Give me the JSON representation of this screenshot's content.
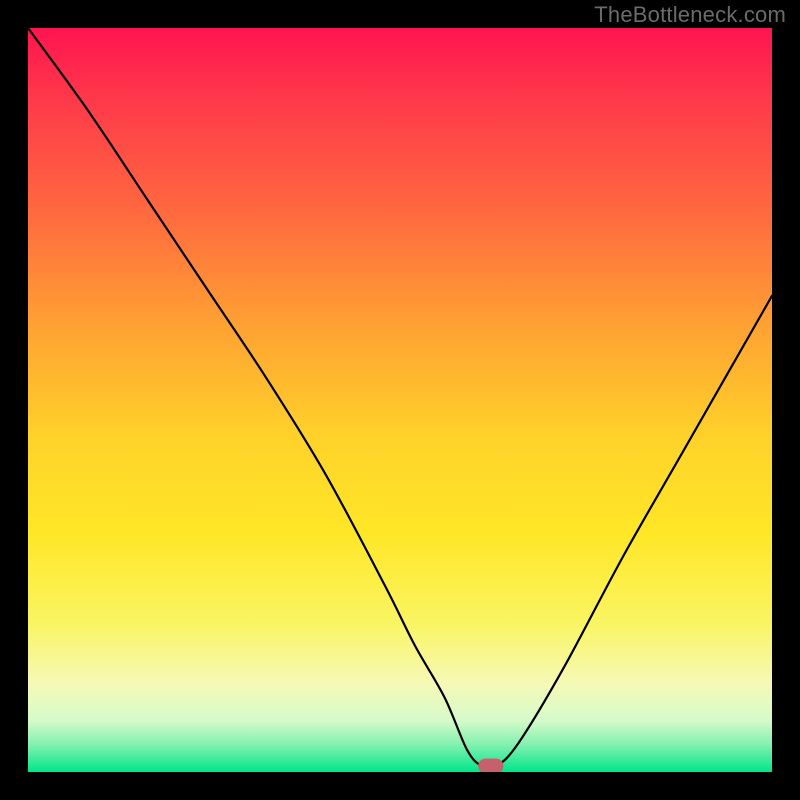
{
  "watermark": "TheBottleneck.com",
  "chart_data": {
    "type": "line",
    "title": "",
    "xlabel": "",
    "ylabel": "",
    "xlim": [
      0,
      100
    ],
    "ylim": [
      0,
      100
    ],
    "x": [
      0,
      8,
      16,
      24,
      32,
      40,
      48,
      52,
      56,
      59,
      61,
      63,
      66,
      72,
      80,
      88,
      96,
      100
    ],
    "values": [
      100,
      89,
      77,
      65,
      53,
      40,
      25,
      17,
      10,
      3,
      0.8,
      0.8,
      4,
      14,
      29,
      43,
      57,
      64
    ],
    "marker": {
      "x": 62.2,
      "y": 0.8,
      "w": 3.4,
      "h": 2.0
    },
    "gradient_stops": [
      {
        "offset": 0.0,
        "color": "#ff1450"
      },
      {
        "offset": 0.1,
        "color": "#ff3a4a"
      },
      {
        "offset": 0.25,
        "color": "#ff6a3f"
      },
      {
        "offset": 0.4,
        "color": "#ffa133"
      },
      {
        "offset": 0.55,
        "color": "#ffd22a"
      },
      {
        "offset": 0.68,
        "color": "#ffe727"
      },
      {
        "offset": 0.8,
        "color": "#f9f562"
      },
      {
        "offset": 0.88,
        "color": "#f6f9b5"
      },
      {
        "offset": 0.93,
        "color": "#d7faca"
      },
      {
        "offset": 0.965,
        "color": "#7ef0ae"
      },
      {
        "offset": 1.0,
        "color": "#00e589"
      }
    ]
  }
}
